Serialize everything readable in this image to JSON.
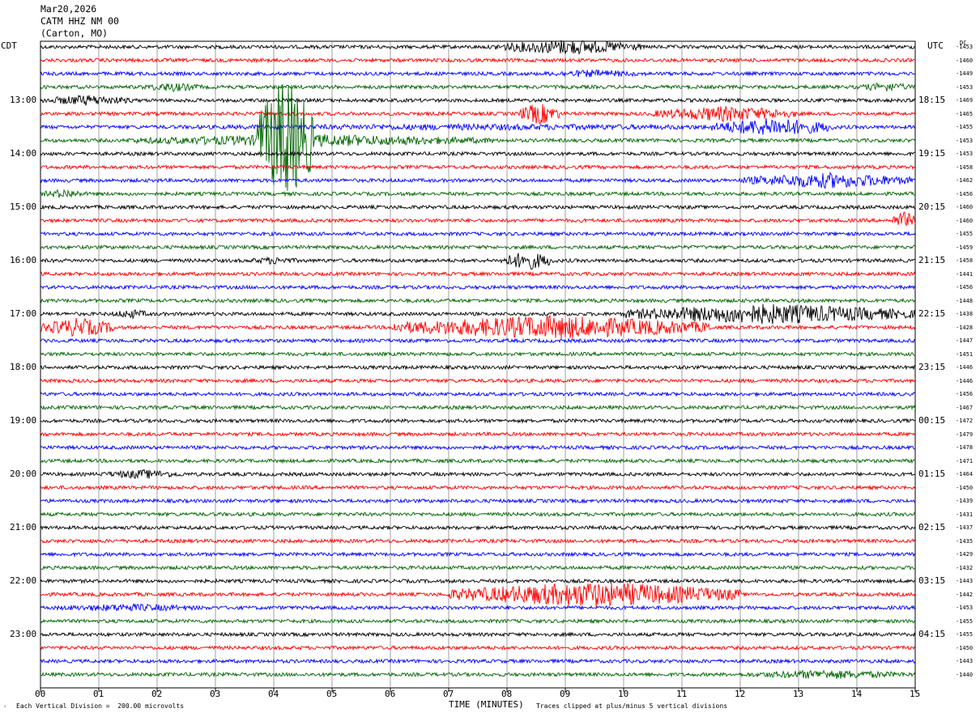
{
  "header": {
    "date": "Mar20,2026",
    "station": "CATM HHZ NM 00",
    "location": "(Carton, MO)"
  },
  "left_zone_label": "CDT",
  "right_zone_label": "UTC",
  "dc_label": "DC",
  "footer": {
    "scale_note": "Each Vertical Division =  200.00 microvolts",
    "clip_note": "Traces clipped at plus/minus 5 vertical divisions",
    "xaxis_title": "TIME (MINUTES)"
  },
  "chart_data": {
    "type": "line",
    "title": "",
    "xlabel": "TIME (MINUTES)",
    "xlim": [
      0,
      15
    ],
    "x_ticks": [
      "00",
      "01",
      "02",
      "03",
      "04",
      "05",
      "06",
      "07",
      "08",
      "09",
      "10",
      "11",
      "12",
      "13",
      "14",
      "15"
    ],
    "left_hour_labels": [
      "13:00",
      "14:00",
      "15:00",
      "16:00",
      "17:00",
      "18:00",
      "19:00",
      "20:00",
      "21:00",
      "22:00",
      "23:00"
    ],
    "right_hour_labels": [
      "18:15",
      "19:15",
      "20:15",
      "21:15",
      "22:15",
      "23:15",
      "00:15",
      "01:15",
      "02:15",
      "03:15",
      "04:15"
    ],
    "trace_colors": [
      "#000000",
      "#ff0000",
      "#0000ff",
      "#006400"
    ],
    "traces_per_hour": 4,
    "minutes_per_trace": 15,
    "dc_offsets": [
      -1453,
      -1460,
      -1449,
      -1453,
      -1469,
      -1465,
      -1455,
      -1453,
      -1453,
      -1458,
      -1462,
      -1456,
      -1460,
      -1460,
      -1455,
      -1459,
      -1458,
      -1441,
      -1456,
      -1448,
      -1438,
      -1428,
      -1447,
      -1451,
      -1446,
      -1446,
      -1456,
      -1467,
      -1472,
      -1479,
      -1478,
      -1471,
      -1464,
      -1450,
      -1439,
      -1431,
      -1437,
      -1435,
      -1429,
      -1432,
      -1443,
      -1442,
      -1453,
      -1455,
      -1455,
      -1450,
      -1443,
      -1440
    ],
    "events": [
      {
        "trace": 0,
        "start_min": 7.8,
        "end_min": 10.3,
        "amp": 10
      },
      {
        "trace": 2,
        "start_min": 8.5,
        "end_min": 10.5,
        "amp": 5
      },
      {
        "trace": 3,
        "start_min": 1.7,
        "end_min": 2.8,
        "amp": 6
      },
      {
        "trace": 3,
        "start_min": 14.0,
        "end_min": 15.0,
        "amp": 6
      },
      {
        "trace": 4,
        "start_min": 0.0,
        "end_min": 1.6,
        "amp": 7
      },
      {
        "trace": 5,
        "start_min": 8.2,
        "end_min": 8.9,
        "amp": 14
      },
      {
        "trace": 5,
        "start_min": 10.5,
        "end_min": 13.0,
        "amp": 10
      },
      {
        "trace": 6,
        "start_min": 0.0,
        "end_min": 15.0,
        "amp": 4
      },
      {
        "trace": 6,
        "start_min": 11.5,
        "end_min": 13.6,
        "amp": 12
      },
      {
        "trace": 7,
        "start_min": 1.5,
        "end_min": 7.8,
        "amp": 8
      },
      {
        "trace": 7,
        "start_min": 3.7,
        "end_min": 4.7,
        "amp": 80
      },
      {
        "trace": 10,
        "start_min": 12.0,
        "end_min": 15.0,
        "amp": 10
      },
      {
        "trace": 11,
        "start_min": 0.0,
        "end_min": 0.8,
        "amp": 6
      },
      {
        "trace": 13,
        "start_min": 14.6,
        "end_min": 15.0,
        "amp": 12
      },
      {
        "trace": 16,
        "start_min": 3.5,
        "end_min": 4.5,
        "amp": 5
      },
      {
        "trace": 16,
        "start_min": 7.9,
        "end_min": 8.8,
        "amp": 12
      },
      {
        "trace": 20,
        "start_min": 1.2,
        "end_min": 1.9,
        "amp": 6
      },
      {
        "trace": 20,
        "start_min": 10.0,
        "end_min": 15.0,
        "amp": 13
      },
      {
        "trace": 21,
        "start_min": 0.0,
        "end_min": 1.3,
        "amp": 12
      },
      {
        "trace": 21,
        "start_min": 6.0,
        "end_min": 11.5,
        "amp": 15
      },
      {
        "trace": 32,
        "start_min": 1.0,
        "end_min": 2.5,
        "amp": 6
      },
      {
        "trace": 41,
        "start_min": 7.0,
        "end_min": 12.0,
        "amp": 16
      },
      {
        "trace": 42,
        "start_min": 0.0,
        "end_min": 3.0,
        "amp": 5
      },
      {
        "trace": 47,
        "start_min": 12.0,
        "end_min": 15.0,
        "amp": 6
      }
    ]
  }
}
